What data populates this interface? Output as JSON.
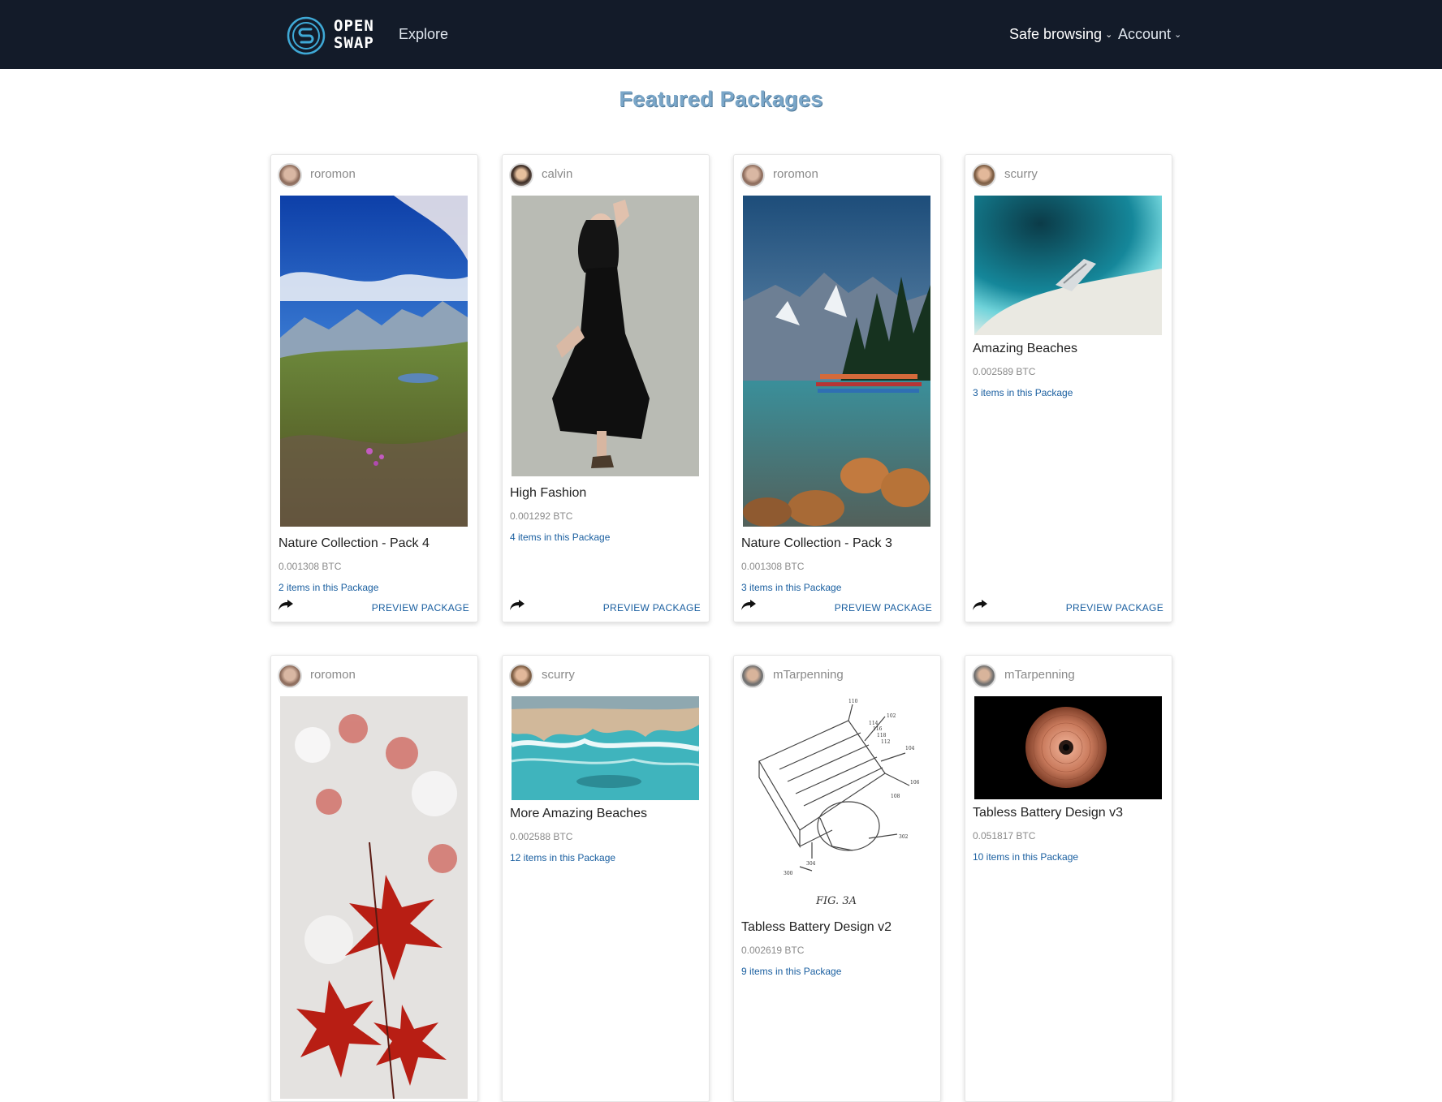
{
  "nav": {
    "logo_line1": "OPEN",
    "logo_line2": "SWAP",
    "explore": "Explore",
    "safe_browsing": "Safe browsing",
    "account": "Account"
  },
  "page_title": "Featured Packages",
  "colors": {
    "navbar": "#131b29",
    "accent": "#1a5fa0",
    "title": "#7aa6c8"
  },
  "packages": [
    {
      "user": "roromon",
      "title": "Nature Collection - Pack 4",
      "price": "0.001308 BTC",
      "count": "2 items in this Package",
      "preview": "PREVIEW PACKAGE"
    },
    {
      "user": "calvin",
      "title": "High Fashion",
      "price": "0.001292 BTC",
      "count": "4 items in this Package",
      "preview": "PREVIEW PACKAGE"
    },
    {
      "user": "roromon",
      "title": "Nature Collection - Pack 3",
      "price": "0.001308 BTC",
      "count": "3 items in this Package",
      "preview": "PREVIEW PACKAGE"
    },
    {
      "user": "scurry",
      "title": "Amazing Beaches",
      "price": "0.002589 BTC",
      "count": "3 items in this Package",
      "preview": "PREVIEW PACKAGE"
    },
    {
      "user": "roromon"
    },
    {
      "user": "scurry",
      "title": "More Amazing Beaches",
      "price": "0.002588 BTC",
      "count": "12 items in this Package"
    },
    {
      "user": "mTarpenning",
      "title": "Tabless Battery Design v2",
      "price": "0.002619 BTC",
      "count": "9 items in this Package",
      "figure_caption": "FIG. 3A",
      "figure_labels": [
        "110",
        "102",
        "114",
        "116",
        "118",
        "112",
        "302",
        "304",
        "300",
        "104",
        "106",
        "108"
      ]
    },
    {
      "user": "mTarpenning",
      "title": "Tabless Battery Design v3",
      "price": "0.051817 BTC",
      "count": "10 items in this Package"
    }
  ]
}
